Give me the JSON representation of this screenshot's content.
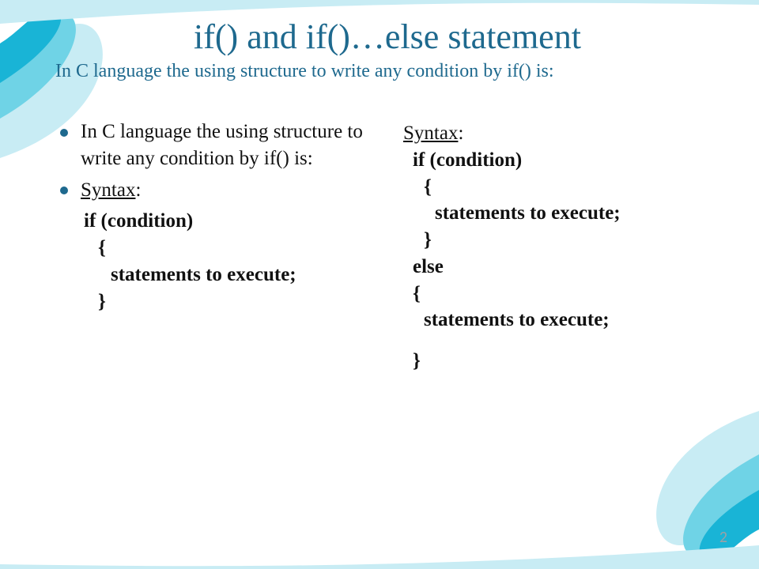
{
  "header": {
    "title": "if()  and if()…else  statement",
    "subtitle": "In C language the using structure to write any condition by if() is:"
  },
  "left": {
    "bullet1": "In C language the using structure to write any condition by if() is:",
    "bullet2": "Syntax",
    "bullet2_colon": ":",
    "code": {
      "l1": "if (condition)",
      "l2": "{",
      "l3": "statements to execute;",
      "l4": "}"
    }
  },
  "right": {
    "syntax_label": "Syntax",
    "syntax_colon": ":",
    "code": {
      "l1": "if (condition)",
      "l2": "{",
      "l3": "statements to execute;",
      "l4": "}",
      "l5": "else",
      "l6": "{",
      "l7": "statements to execute;",
      "l8": "}"
    }
  },
  "pageNumber": "2"
}
